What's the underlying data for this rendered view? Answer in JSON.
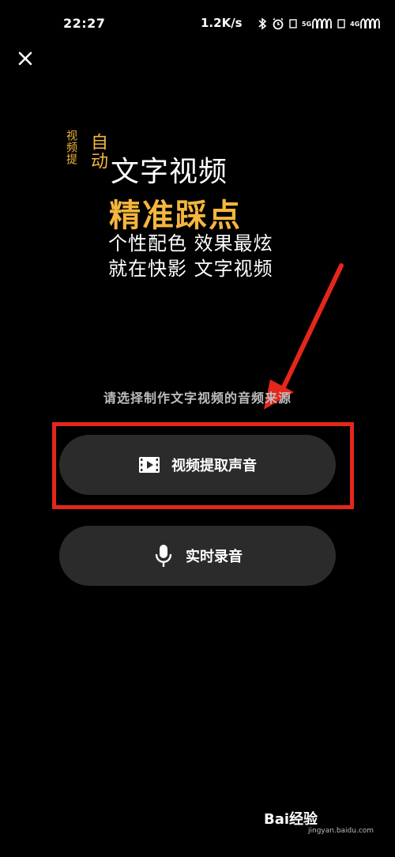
{
  "status_bar": {
    "time": "22:27",
    "net_speed": "1.2K/s",
    "sim1_label": "5G",
    "sim2_label": "4G",
    "battery": "49"
  },
  "icons": {
    "close": "close-icon",
    "bluetooth": "bluetooth-icon",
    "alarm": "alarm-icon",
    "video": "video-icon",
    "microphone": "microphone-icon"
  },
  "promo": {
    "vertical_small": "视频提",
    "vertical_big": "自动",
    "line1": "文字视频",
    "line2": "精准踩点",
    "line3": "个性配色 效果最炫",
    "line4": "就在快影 文字视频"
  },
  "prompt": "请选择制作文字视频的音频来源",
  "options": [
    {
      "label": "视频提取声音"
    },
    {
      "label": "实时录音"
    }
  ],
  "colors": {
    "accent": "#f4b63d",
    "button_bg": "#2b2b2b",
    "annotation_red": "#e5261a"
  },
  "watermark": {
    "text": "Bai经验",
    "sub": "jingyan.baidu.com"
  }
}
